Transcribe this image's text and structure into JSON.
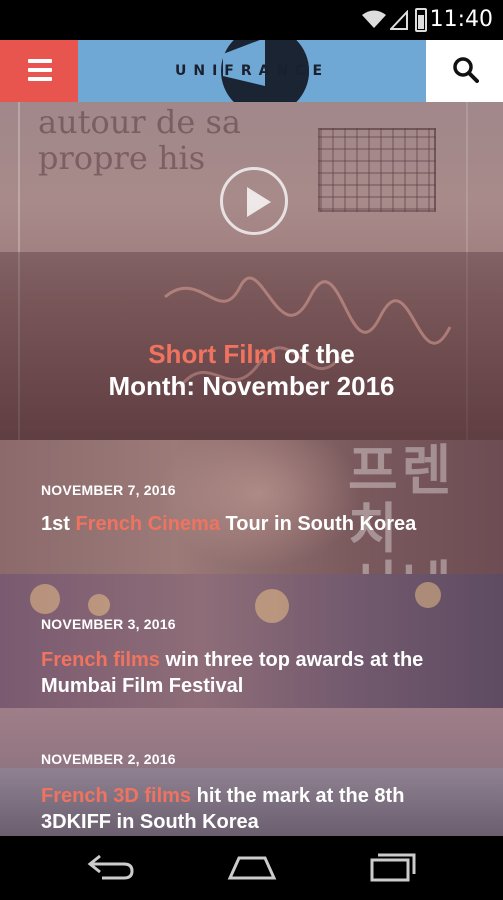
{
  "status_bar": {
    "time": "11:40"
  },
  "header": {
    "logo_text": "UNIFRANCE"
  },
  "hero": {
    "title_accent": "Short Film",
    "title_rest_line1": " of the",
    "title_line2": "Month: November 2016"
  },
  "articles": [
    {
      "date": "NOVEMBER 7, 2016",
      "title_pre": "1st ",
      "title_accent": "French Cinema",
      "title_post": " Tour in South Korea"
    },
    {
      "date": "NOVEMBER 3, 2016",
      "title_pre": "",
      "title_accent": "French films",
      "title_post": " win three top awards at the Mumbai Film Festival"
    },
    {
      "date": "NOVEMBER 2, 2016",
      "title_pre": "",
      "title_accent": "French 3D films",
      "title_post": " hit the mark at the 8th 3DKIFF in South Korea"
    }
  ],
  "icons": {
    "menu": "hamburger-icon",
    "search": "search-icon",
    "play": "play-icon",
    "back": "back-icon",
    "home": "home-icon",
    "recents": "recents-icon"
  },
  "colors": {
    "accent": "#f0735f",
    "menu_bg": "#e8554f",
    "header_bg": "#6fa8d4"
  }
}
